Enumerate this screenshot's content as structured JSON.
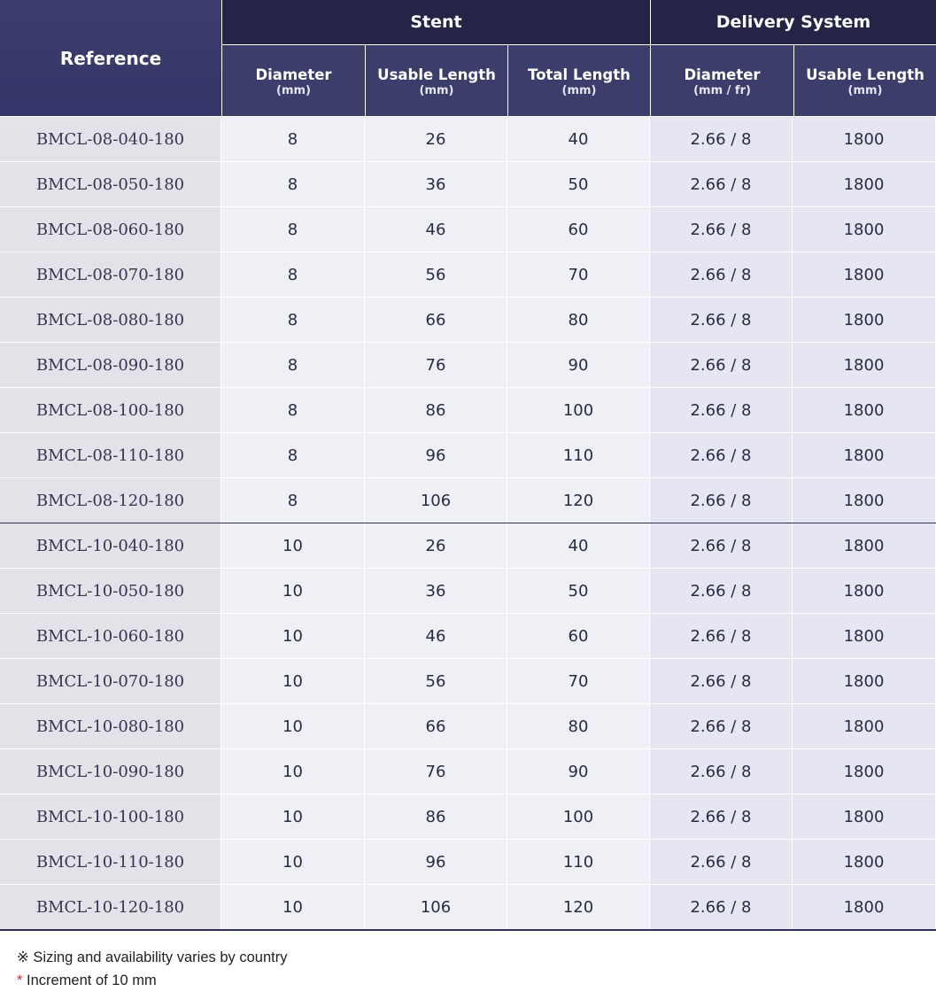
{
  "header": {
    "reference": "Reference",
    "stent_group": "Stent",
    "delivery_group": "Delivery System",
    "columns": [
      {
        "label": "Diameter",
        "unit": "(mm)"
      },
      {
        "label": "Usable Length",
        "unit": "(mm)"
      },
      {
        "label": "Total Length",
        "unit": "(mm)"
      },
      {
        "label": "Diameter",
        "unit": "(mm / fr)"
      },
      {
        "label": "Usable Length",
        "unit": "(mm)"
      }
    ]
  },
  "rows": [
    {
      "reference": "BMCL-08-040-180",
      "stent_diameter": "8",
      "usable_length": "26",
      "total_length": "40",
      "ds_diameter": "2.66 / 8",
      "ds_usable_length": "1800"
    },
    {
      "reference": "BMCL-08-050-180",
      "stent_diameter": "8",
      "usable_length": "36",
      "total_length": "50",
      "ds_diameter": "2.66 / 8",
      "ds_usable_length": "1800"
    },
    {
      "reference": "BMCL-08-060-180",
      "stent_diameter": "8",
      "usable_length": "46",
      "total_length": "60",
      "ds_diameter": "2.66 / 8",
      "ds_usable_length": "1800"
    },
    {
      "reference": "BMCL-08-070-180",
      "stent_diameter": "8",
      "usable_length": "56",
      "total_length": "70",
      "ds_diameter": "2.66 / 8",
      "ds_usable_length": "1800"
    },
    {
      "reference": "BMCL-08-080-180",
      "stent_diameter": "8",
      "usable_length": "66",
      "total_length": "80",
      "ds_diameter": "2.66 / 8",
      "ds_usable_length": "1800"
    },
    {
      "reference": "BMCL-08-090-180",
      "stent_diameter": "8",
      "usable_length": "76",
      "total_length": "90",
      "ds_diameter": "2.66 / 8",
      "ds_usable_length": "1800"
    },
    {
      "reference": "BMCL-08-100-180",
      "stent_diameter": "8",
      "usable_length": "86",
      "total_length": "100",
      "ds_diameter": "2.66 / 8",
      "ds_usable_length": "1800"
    },
    {
      "reference": "BMCL-08-110-180",
      "stent_diameter": "8",
      "usable_length": "96",
      "total_length": "110",
      "ds_diameter": "2.66 / 8",
      "ds_usable_length": "1800"
    },
    {
      "reference": "BMCL-08-120-180",
      "stent_diameter": "8",
      "usable_length": "106",
      "total_length": "120",
      "ds_diameter": "2.66 / 8",
      "ds_usable_length": "1800"
    },
    {
      "reference": "BMCL-10-040-180",
      "stent_diameter": "10",
      "usable_length": "26",
      "total_length": "40",
      "ds_diameter": "2.66 / 8",
      "ds_usable_length": "1800"
    },
    {
      "reference": "BMCL-10-050-180",
      "stent_diameter": "10",
      "usable_length": "36",
      "total_length": "50",
      "ds_diameter": "2.66 / 8",
      "ds_usable_length": "1800"
    },
    {
      "reference": "BMCL-10-060-180",
      "stent_diameter": "10",
      "usable_length": "46",
      "total_length": "60",
      "ds_diameter": "2.66 / 8",
      "ds_usable_length": "1800"
    },
    {
      "reference": "BMCL-10-070-180",
      "stent_diameter": "10",
      "usable_length": "56",
      "total_length": "70",
      "ds_diameter": "2.66 / 8",
      "ds_usable_length": "1800"
    },
    {
      "reference": "BMCL-10-080-180",
      "stent_diameter": "10",
      "usable_length": "66",
      "total_length": "80",
      "ds_diameter": "2.66 / 8",
      "ds_usable_length": "1800"
    },
    {
      "reference": "BMCL-10-090-180",
      "stent_diameter": "10",
      "usable_length": "76",
      "total_length": "90",
      "ds_diameter": "2.66 / 8",
      "ds_usable_length": "1800"
    },
    {
      "reference": "BMCL-10-100-180",
      "stent_diameter": "10",
      "usable_length": "86",
      "total_length": "100",
      "ds_diameter": "2.66 / 8",
      "ds_usable_length": "1800"
    },
    {
      "reference": "BMCL-10-110-180",
      "stent_diameter": "10",
      "usable_length": "96",
      "total_length": "110",
      "ds_diameter": "2.66 / 8",
      "ds_usable_length": "1800"
    },
    {
      "reference": "BMCL-10-120-180",
      "stent_diameter": "10",
      "usable_length": "106",
      "total_length": "120",
      "ds_diameter": "2.66 / 8",
      "ds_usable_length": "1800"
    }
  ],
  "footer": {
    "note": "※ Sizing and availability varies by country",
    "increment_marker": "*",
    "increment_text": " Increment of 10 mm"
  },
  "colors": {
    "header_dark": "#242447",
    "header_mid": "#3b3d6b",
    "reference_cell": "#e3e2e8",
    "stent_cell": "#efeff6",
    "delivery_cell": "#e6e6f3",
    "asterisk": "#d12c2c"
  }
}
